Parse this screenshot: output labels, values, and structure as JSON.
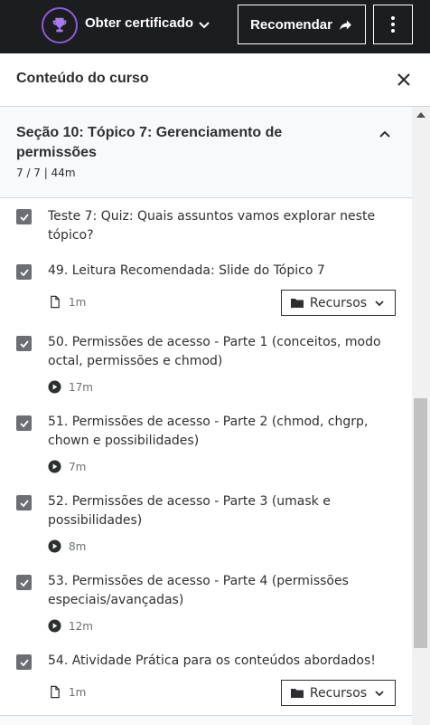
{
  "topbar": {
    "certificate_label": "Obter certificado",
    "recommend_label": "Recomendar"
  },
  "sidebar": {
    "title": "Conteúdo do curso"
  },
  "section": {
    "title": "Seção 10: Tópico 7: Gerenciamento de permissões",
    "meta": "7 / 7 | 44m"
  },
  "items": [
    {
      "title": "Teste 7: Quiz: Quais assuntos vamos explorar neste tópico?",
      "checked": true
    },
    {
      "title": "49. Leitura Recomendada: Slide do Tópico 7",
      "checked": true,
      "type_icon": "document-icon",
      "duration": "1m",
      "resources_label": "Recursos"
    },
    {
      "title": "50. Permissões de acesso - Parte 1 (conceitos, modo octal, permissões e chmod)",
      "checked": true,
      "type_icon": "play-icon",
      "duration": "17m"
    },
    {
      "title": "51. Permissões de acesso - Parte 2 (chmod, chgrp, chown e possibilidades)",
      "checked": true,
      "type_icon": "play-icon",
      "duration": "7m"
    },
    {
      "title": "52. Permissões de acesso - Parte 3 (umask e possibilidades)",
      "checked": true,
      "type_icon": "play-icon",
      "duration": "8m"
    },
    {
      "title": "53. Permissões de acesso - Parte 4 (permissões especiais/avançadas)",
      "checked": true,
      "type_icon": "play-icon",
      "duration": "12m"
    },
    {
      "title": "54. Atividade Prática para os conteúdos abordados!",
      "checked": true,
      "type_icon": "document-icon",
      "duration": "1m",
      "resources_label": "Recursos"
    }
  ],
  "colors": {
    "topbar_bg": "#1c1d1f",
    "trophy_ring": "#8a5cd8",
    "checkbox": "#6a6f73",
    "section_bg": "#f7f9fa"
  }
}
